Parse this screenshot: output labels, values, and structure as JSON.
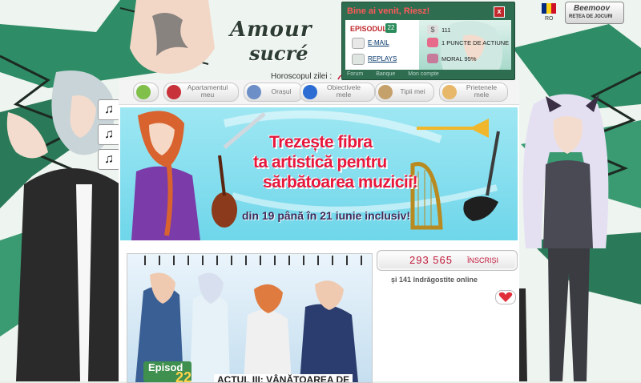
{
  "logo": {
    "line1": "Amour",
    "line2": "sucré"
  },
  "horoscope": {
    "label": "Horoscopul zilei :"
  },
  "welcome": {
    "title": "Bine ai venit, Riesz!",
    "close": "x",
    "episode_label": "EPISODUL",
    "episode_number": "22",
    "dollars": "111",
    "action_points": "1 PUNCTE DE ACTIUNE",
    "moral": "MORAL 95%",
    "email_link": "E-MAIL",
    "replays_link": "REPLAYS",
    "tabs": [
      "Forum",
      "Banque",
      "Mon compte"
    ]
  },
  "language": {
    "code": "RO"
  },
  "beemoov": {
    "name": "Beemoov",
    "tagline": "REȚEA DE JOCURI"
  },
  "music_notes": [
    "♫",
    "♫",
    "♫"
  ],
  "nav": {
    "items": [
      {
        "label": "",
        "icon": "home-icon"
      },
      {
        "label": "Apartamentul meu",
        "icon": "sofa-icon"
      },
      {
        "label": "Orașul",
        "icon": "building-icon"
      },
      {
        "label": "Obiectivele mele",
        "icon": "target-icon"
      },
      {
        "label": "Tipii mei",
        "icon": "boy-icon"
      },
      {
        "label": "Prietenele mele",
        "icon": "girl-icon"
      }
    ]
  },
  "banner": {
    "line1": "Trezește fibra",
    "line2": "ta artistică pentru",
    "line3": "sărbătoarea muzicii!",
    "dates": "din 19 până în 21 iunie inclusiv!"
  },
  "episode": {
    "label": "Episod",
    "number": "22",
    "title": "ACTUL III: VÂNĂTOAREA DE"
  },
  "stats": {
    "count": "293 565",
    "count_suffix": "ÎNSCRIȘI",
    "online": "și 141 îndrăgostite online"
  },
  "colors": {
    "panel_green": "#2f6d50",
    "accent_red": "#c1183a",
    "banner_cyan": "#6fd6ea"
  }
}
